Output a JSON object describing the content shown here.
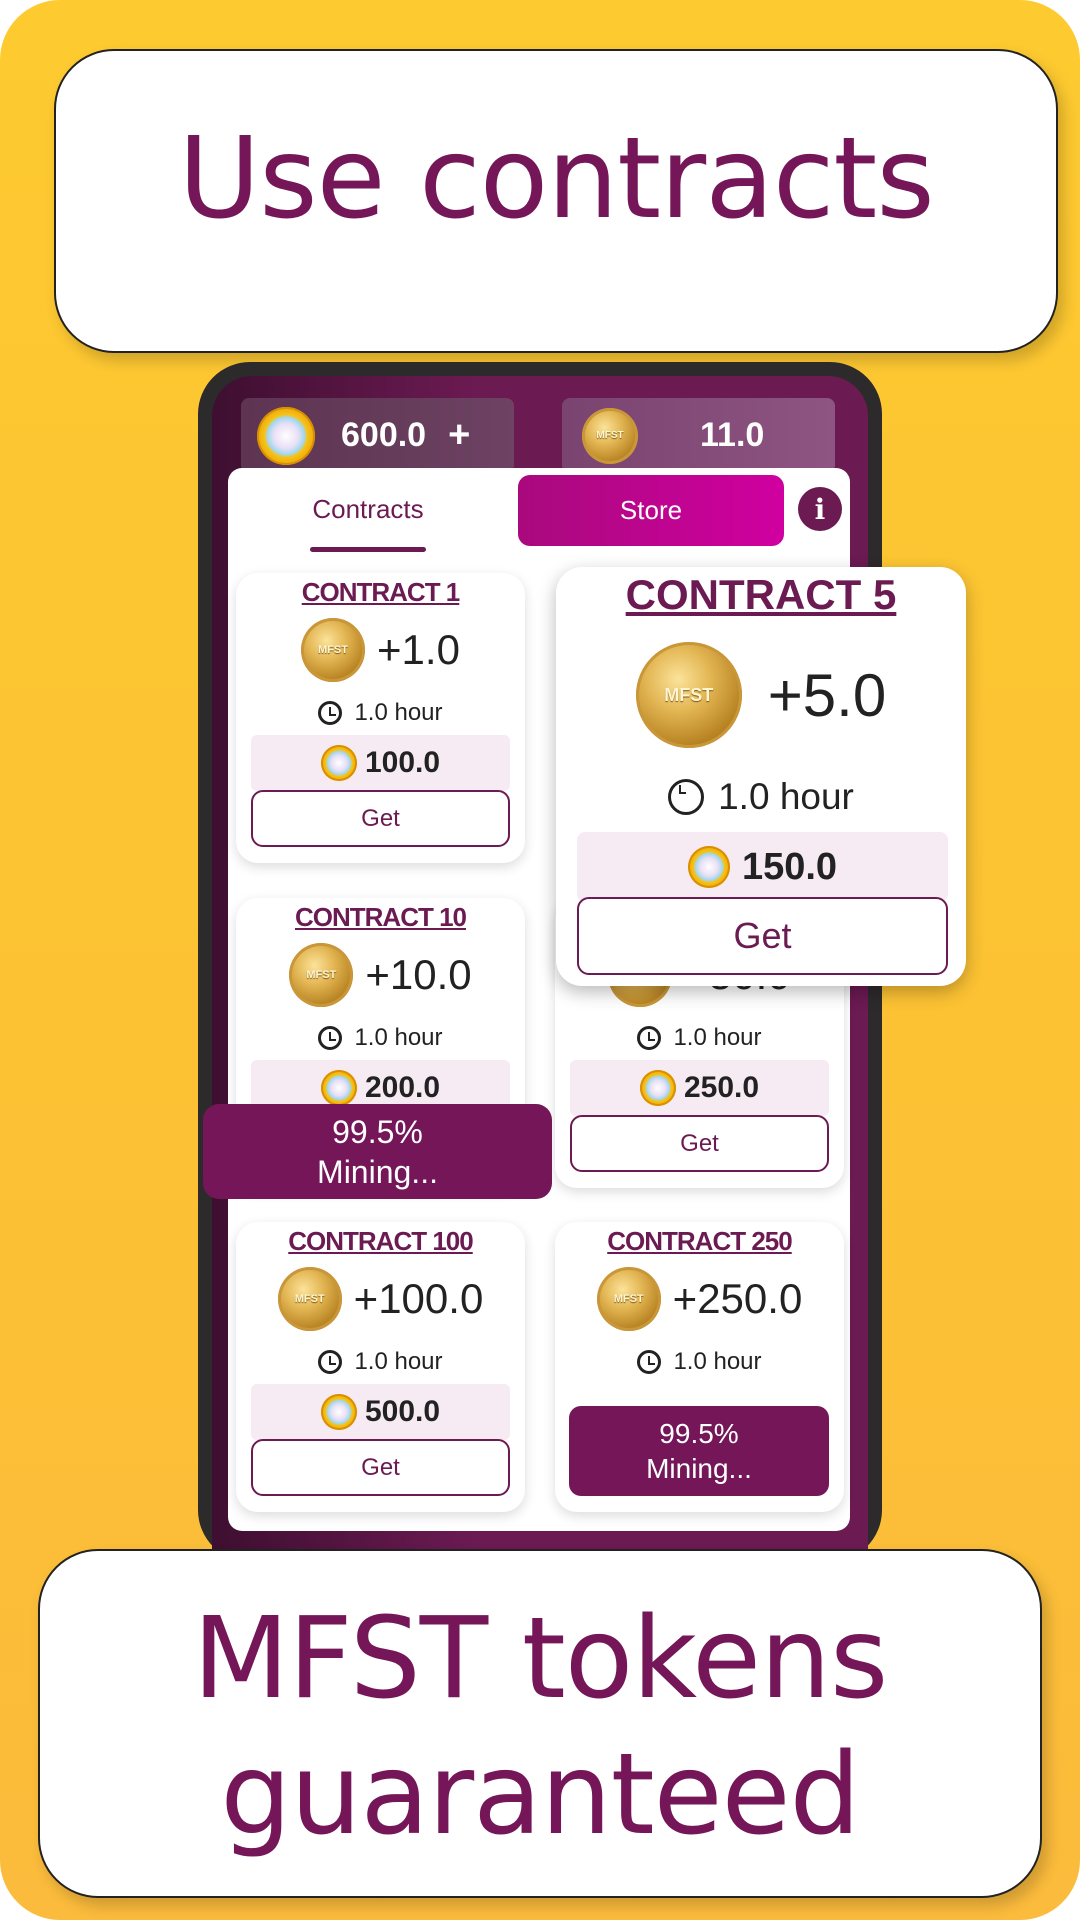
{
  "headline_top": "Use contracts",
  "headline_bottom": [
    "MFST tokens",
    "guaranteed"
  ],
  "coin_logo_text": "MFST",
  "colors": {
    "brand": "#741658",
    "store_tab": "#c8009a",
    "background": "#fdc932"
  },
  "balances": {
    "diamonds": "600.0",
    "add_label": "+",
    "mfst": "11.0"
  },
  "tabs": {
    "contracts": "Contracts",
    "store": "Store",
    "active": "Contracts"
  },
  "info_icon": "i",
  "cards": [
    {
      "title": "CONTRACT 1",
      "reward": "+1.0",
      "duration": "1.0 hour",
      "price": "100.0",
      "button": "Get"
    },
    {
      "title": "",
      "reward": "+50.0",
      "duration": "1.0 hour",
      "price": "250.0",
      "button": "Get"
    },
    {
      "title": "CONTRACT 10",
      "reward": "+10.0",
      "duration": "1.0 hour",
      "price": "200.0",
      "button": ""
    },
    {
      "title": "CONTRACT 100",
      "reward": "+100.0",
      "duration": "1.0 hour",
      "price": "500.0",
      "button": "Get"
    },
    {
      "title": "CONTRACT 250",
      "reward": "+250.0",
      "duration": "1.0 hour",
      "mining_progress": "99.5%",
      "mining_label": "Mining..."
    }
  ],
  "mining_overlay": {
    "progress": "99.5%",
    "label": "Mining..."
  },
  "popup": {
    "title": "CONTRACT 5",
    "reward": "+5.0",
    "duration": "1.0 hour",
    "price": "150.0",
    "button": "Get"
  }
}
